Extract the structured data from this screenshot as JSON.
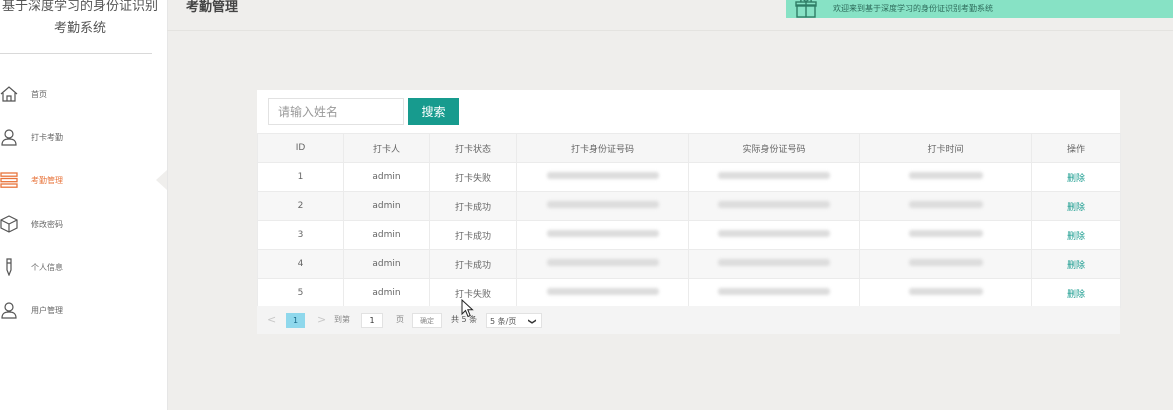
{
  "app": {
    "brand_line1": "基于深度学习的身份证识别",
    "brand_line2": "考勤系统"
  },
  "header": {
    "title": "考勤管理",
    "welcome": "欢迎来到基于深度学习的身份证识别考勤系统"
  },
  "sidebar": {
    "items": [
      {
        "label": "首页",
        "icon": "home-icon"
      },
      {
        "label": "打卡考勤",
        "icon": "user-icon"
      },
      {
        "label": "考勤管理",
        "icon": "list-icon",
        "active": true
      },
      {
        "label": "修改密码",
        "icon": "cube-icon"
      },
      {
        "label": "个人信息",
        "icon": "pen-icon"
      },
      {
        "label": "用户管理",
        "icon": "user-icon"
      }
    ]
  },
  "search": {
    "placeholder": "请输入姓名",
    "button": "搜索"
  },
  "table": {
    "columns": [
      "ID",
      "打卡人",
      "打卡状态",
      "打卡身份证号码",
      "实际身份证号码",
      "打卡时间",
      "操作"
    ],
    "rows": [
      {
        "id": "1",
        "name": "admin",
        "status": "打卡失败",
        "action": "删除"
      },
      {
        "id": "2",
        "name": "admin",
        "status": "打卡成功",
        "action": "删除"
      },
      {
        "id": "3",
        "name": "admin",
        "status": "打卡成功",
        "action": "删除"
      },
      {
        "id": "4",
        "name": "admin",
        "status": "打卡成功",
        "action": "删除"
      },
      {
        "id": "5",
        "name": "admin",
        "status": "打卡失败",
        "action": "删除"
      }
    ]
  },
  "pager": {
    "prev": "<",
    "current": "1",
    "next": ">",
    "goto_label": "到第",
    "goto_value": "1",
    "page_unit": "页",
    "confirm": "确定",
    "total": "共 5 条",
    "page_size": "5 条/页"
  },
  "colors": {
    "accent": "#179b8e",
    "active_nav": "#e8743b",
    "welcome_bg": "#87e2c5"
  }
}
